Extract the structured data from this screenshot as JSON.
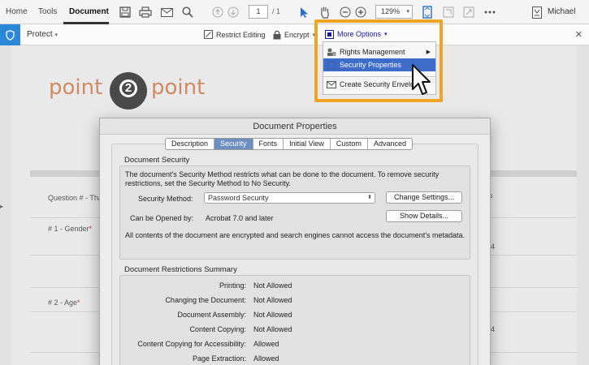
{
  "topbar": {
    "tabs": [
      "Home",
      "Tools",
      "Document"
    ],
    "page_current": "1",
    "page_total": "/ 1",
    "zoom": "129%",
    "user": "Michael"
  },
  "protectbar": {
    "label": "Protect",
    "restrict_editing": "Restrict Editing",
    "encrypt": "Encrypt",
    "more_options": "More Options"
  },
  "menu": {
    "items": [
      "Rights Management",
      "Security Properties",
      "Create Security Envelo"
    ]
  },
  "document": {
    "logo_left": "point",
    "logo_num": "2",
    "logo_right": "point",
    "row_question": "Question # - Tha",
    "row_gender": "# 1 - Gender",
    "row_age": "# 2 - Age",
    "required_mark": "*",
    "right_4a": "4",
    "right_4b": "4",
    "right_s": "s"
  },
  "dialog": {
    "title": "Document Properties",
    "tabs": [
      "Description",
      "Security",
      "Fonts",
      "Initial View",
      "Custom",
      "Advanced"
    ],
    "section_security": "Document Security",
    "security_desc": "The document's Security Method restricts what can be done to the document. To remove security restrictions, set the Security Method to No Security.",
    "security_method_label": "Security Method:",
    "security_method_value": "Password Security",
    "change_settings": "Change Settings...",
    "opened_by_label": "Can be Opened by:",
    "opened_by_value": "Acrobat 7.0 and later",
    "show_details": "Show Details...",
    "encrypted_note": "All contents of the document are encrypted and search engines cannot access the document's metadata.",
    "section_restrictions": "Document Restrictions Summary",
    "restrictions": [
      {
        "label": "Printing:",
        "value": "Not Allowed"
      },
      {
        "label": "Changing the Document:",
        "value": "Not Allowed"
      },
      {
        "label": "Document Assembly:",
        "value": "Not Allowed"
      },
      {
        "label": "Content Copying:",
        "value": "Not Allowed"
      },
      {
        "label": "Content Copying for Accessibility:",
        "value": "Allowed"
      },
      {
        "label": "Page Extraction:",
        "value": "Allowed"
      }
    ]
  },
  "colors": {
    "accent": "#2b88d8",
    "highlight": "#f0a423",
    "menu_selected": "#3d6cc9",
    "logo": "#d08a63"
  }
}
